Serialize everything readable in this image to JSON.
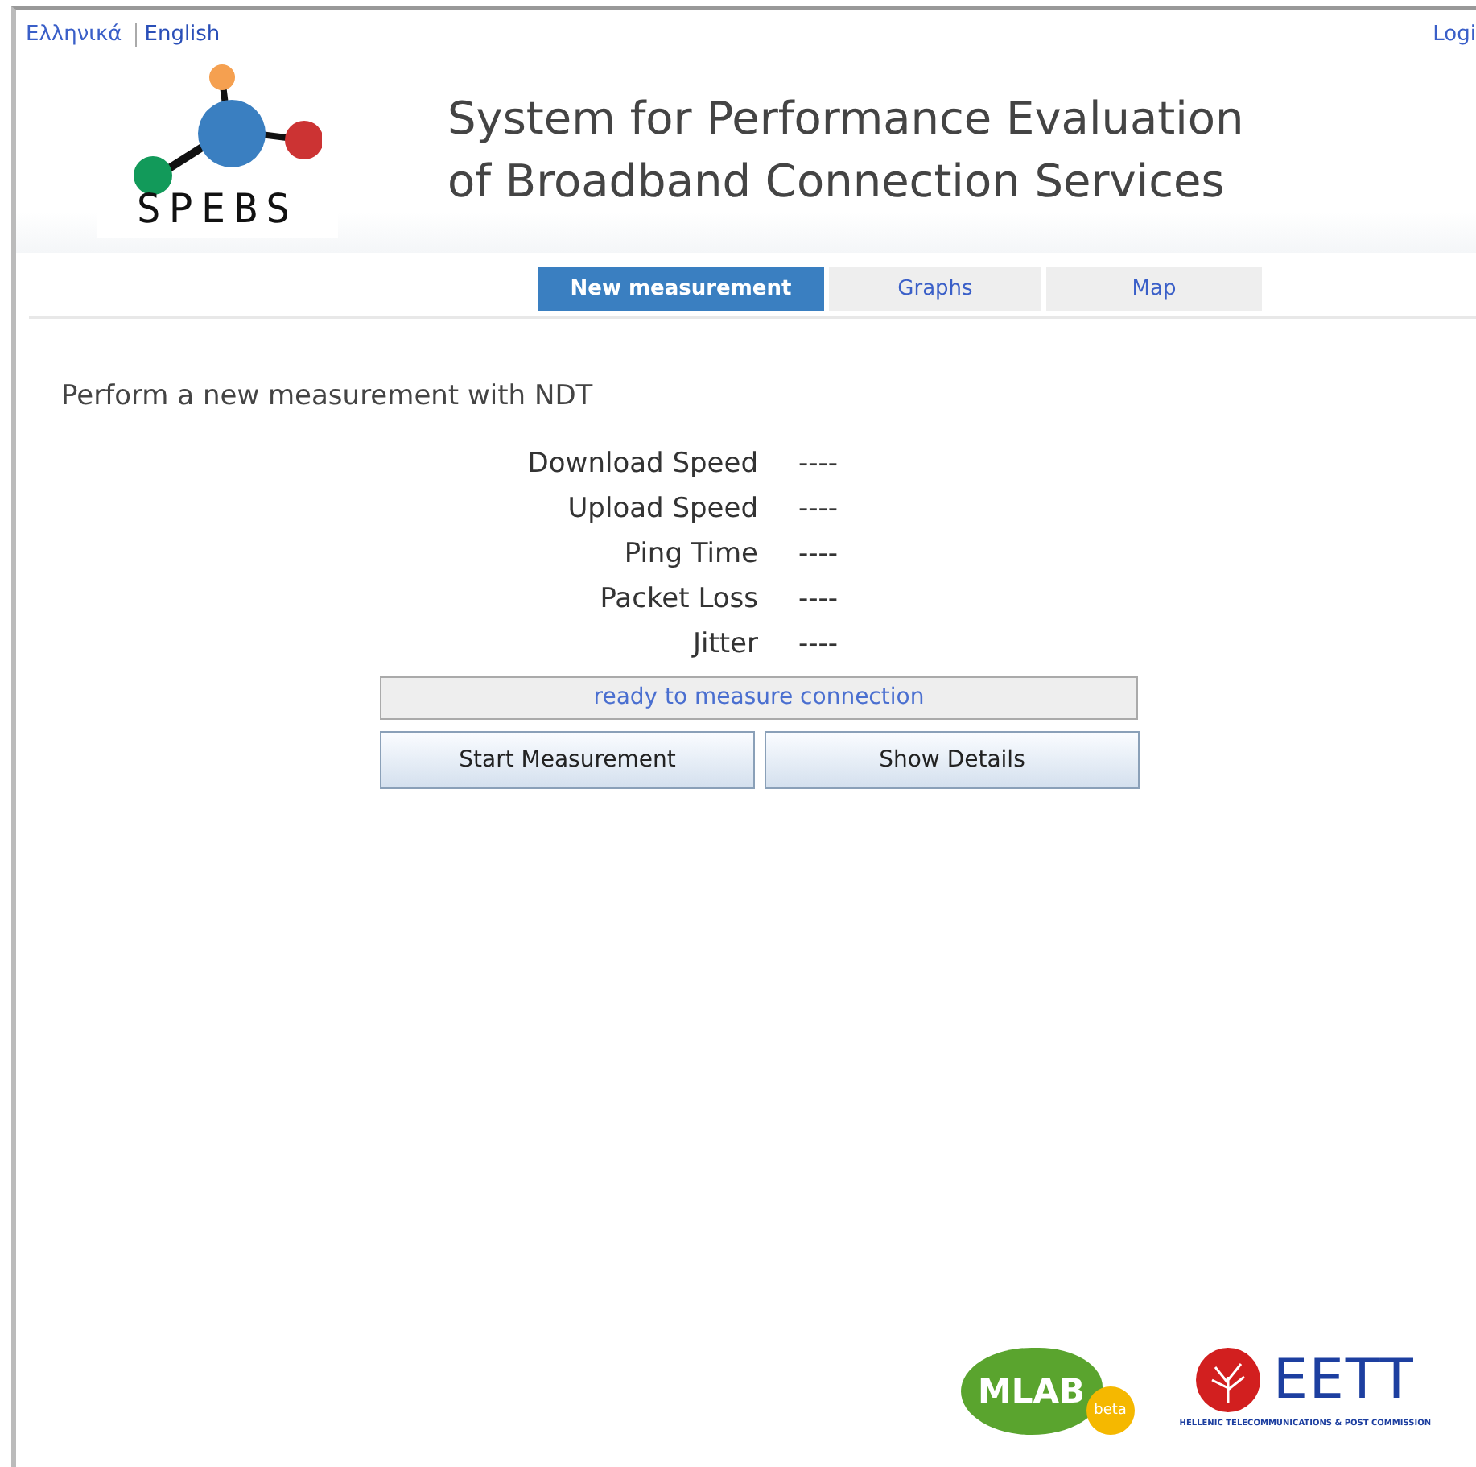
{
  "languages": [
    {
      "label": "Ελληνικά",
      "selected": false
    },
    {
      "label": "English",
      "selected": true
    }
  ],
  "login": "Logi",
  "logo": {
    "text": "SPEBS"
  },
  "title": [
    "System for Performance Evaluation",
    "of Broadband Connection Services"
  ],
  "tabs": [
    {
      "label": "New measurement",
      "selected": true
    },
    {
      "label": "Graphs",
      "selected": false
    },
    {
      "label": "Map",
      "selected": false
    }
  ],
  "heading": "Perform a new measurement with NDT",
  "results": [
    {
      "label": "Download Speed",
      "value": "----"
    },
    {
      "label": "Upload Speed",
      "value": "----"
    },
    {
      "label": "Ping Time",
      "value": "----"
    },
    {
      "label": "Packet Loss",
      "value": "----"
    },
    {
      "label": "Jitter",
      "value": "----"
    }
  ],
  "status": "ready to measure connection",
  "buttons": [
    "Start Measurement",
    "Show Details"
  ],
  "footer_logos": {
    "mlab": "MLAB",
    "mlab_badge": "beta",
    "eett": "EETT",
    "eett_caption": "HELLENIC TELECOMMUNICATIONS & POST COMMISSION"
  }
}
